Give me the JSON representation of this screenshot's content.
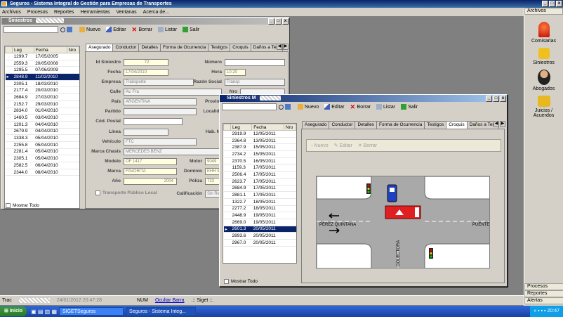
{
  "app": {
    "title": "Seguros - Sistema Integral de Gestión para Empresas de Transportes"
  },
  "menu": [
    "Archivos",
    "Procesos",
    "Reportes",
    "Herramientas",
    "Ventanas",
    "Acerca de..."
  ],
  "right_panel": {
    "header": "Archivos",
    "items": [
      "Comisarias",
      "Siniestros",
      "Abogados",
      "Juicios / Acuerdos"
    ],
    "footer": [
      "Procesos",
      "Reportes",
      "Alertas"
    ]
  },
  "toolbar": {
    "nuevo": "Nuevo",
    "editar": "Editar",
    "borrar": "Borrar",
    "listar": "Listar",
    "salir": "Salir"
  },
  "grid_headers": [
    "Leg",
    "Fecha",
    "Nro"
  ],
  "win1": {
    "title": "Siniestros",
    "rows": [
      [
        "1299.7",
        "17/05/2005"
      ],
      [
        "2559.3",
        "20/05/2008"
      ],
      [
        "1295.5",
        "07/06/2009"
      ],
      [
        "2848.9",
        "11/02/2010"
      ],
      [
        "2305.1",
        "18/03/2010"
      ],
      [
        "2177.4",
        "20/03/2010"
      ],
      [
        "2684.9",
        "27/03/2010"
      ],
      [
        "2152.7",
        "29/03/2010"
      ],
      [
        "2834.0",
        "01/04/2010"
      ],
      [
        "1460.5",
        "03/04/2010"
      ],
      [
        "1201.3",
        "04/04/2010"
      ],
      [
        "2679.9",
        "04/04/2010"
      ],
      [
        "1338.3",
        "05/04/2010"
      ],
      [
        "2255.8",
        "05/04/2010"
      ],
      [
        "2281.4",
        "05/04/2010"
      ],
      [
        "2305.1",
        "05/04/2010"
      ],
      [
        "2582.5",
        "06/04/2010"
      ],
      [
        "2344.0",
        "08/04/2010"
      ]
    ],
    "selected": 3,
    "mostrar_todo": "Mostrar Todo",
    "tabs": [
      "Asegurado",
      "Conductor",
      "Detalles",
      "Forma de Ocurrencia",
      "Testigos",
      "Croquis",
      "Daños a Terc"
    ],
    "form": {
      "id_siniestro_label": "Id Siniestro",
      "id_siniestro": "72",
      "numero_label": "Número",
      "fecha_label": "Fecha",
      "fecha": "17/04/2010",
      "hora_label": "Hora",
      "hora": "10:20",
      "empresa_label": "Empresa",
      "empresa": "Transporte",
      "razon_label": "Razón Social",
      "razon": "Transp",
      "calle_label": "Calle",
      "calle": "Av. Fra",
      "nro_label": "Nro",
      "pais_label": "País",
      "pais": "ARGENTINA",
      "provincia_label": "Provinc",
      "partido_label": "Partido",
      "localidad_label": "Localida",
      "cp_label": "Cód. Postal",
      "linea_label": "Línea",
      "habnr_label": "Hab. Nr",
      "vehiculo_label": "Vehículo",
      "vehiculo": "FTC",
      "marca_chasis_label": "Marca Chasis",
      "marca_chasis": "MERCEDES BENZ",
      "modelo_label": "Modelo",
      "modelo": "OF 1417",
      "motor_label": "Motor",
      "motor": "9049",
      "marca_label": "Marca",
      "marca": "FAVORITA",
      "dominio_label": "Dominio",
      "dominio": "EHH 9",
      "anio_label": "Año",
      "anio": "2004",
      "poliza_label": "Póliza",
      "poliza": "723",
      "transporte_label": "Transporte Público Local",
      "calificacion_label": "Calificación",
      "calificacion": "Sin Re"
    }
  },
  "win2": {
    "title": "Siniestros M",
    "rows": [
      [
        "2919.9",
        "12/05/2011"
      ],
      [
        "2364.8",
        "13/05/2011"
      ],
      [
        "2387.9",
        "15/05/2011"
      ],
      [
        "2734.2",
        "15/05/2011"
      ],
      [
        "2370.5",
        "16/05/2011"
      ],
      [
        "1159.3",
        "17/05/2011"
      ],
      [
        "2506.4",
        "17/05/2011"
      ],
      [
        "2623.7",
        "17/05/2011"
      ],
      [
        "2684.9",
        "17/05/2011"
      ],
      [
        "2881.1",
        "17/05/2011"
      ],
      [
        "1322.7",
        "18/05/2011"
      ],
      [
        "2277.2",
        "18/05/2011"
      ],
      [
        "2448.9",
        "19/05/2011"
      ],
      [
        "2669.0",
        "19/05/2011"
      ],
      [
        "2601.3",
        "20/05/2011"
      ],
      [
        "2893.6",
        "20/05/2011"
      ],
      [
        "2967.0",
        "20/05/2011"
      ]
    ],
    "selected": 14,
    "mostrar_todo": "Mostrar Todo",
    "tabs": [
      "Asegurado",
      "Conductor",
      "Detalles",
      "Forma de Ocurrencia",
      "Testigos",
      "Croquis",
      "Daños a Terc"
    ],
    "croquis_toolbar": {
      "nuevo": "Nuevo",
      "editar": "Editar",
      "borrar": "Borrar"
    },
    "labels": {
      "left": "PEREZ QUINTANA",
      "right": "PUENTE",
      "bottom": "COLECTORA"
    }
  },
  "status": {
    "user": "Trac",
    "datetime": "24/01/2012 20:47:28",
    "num": "NUM",
    "ocultar": "Ocultar Barra",
    "siget": ".:: Siget ::."
  },
  "taskbar": {
    "start": "Inicio",
    "task1": "SIGETSeguros",
    "task2": "Seguros - Sistema Integ...",
    "time": "20:47"
  },
  "colors": {
    "title": "#0a246a",
    "bus": "#e02020",
    "car": "#2040c0"
  }
}
